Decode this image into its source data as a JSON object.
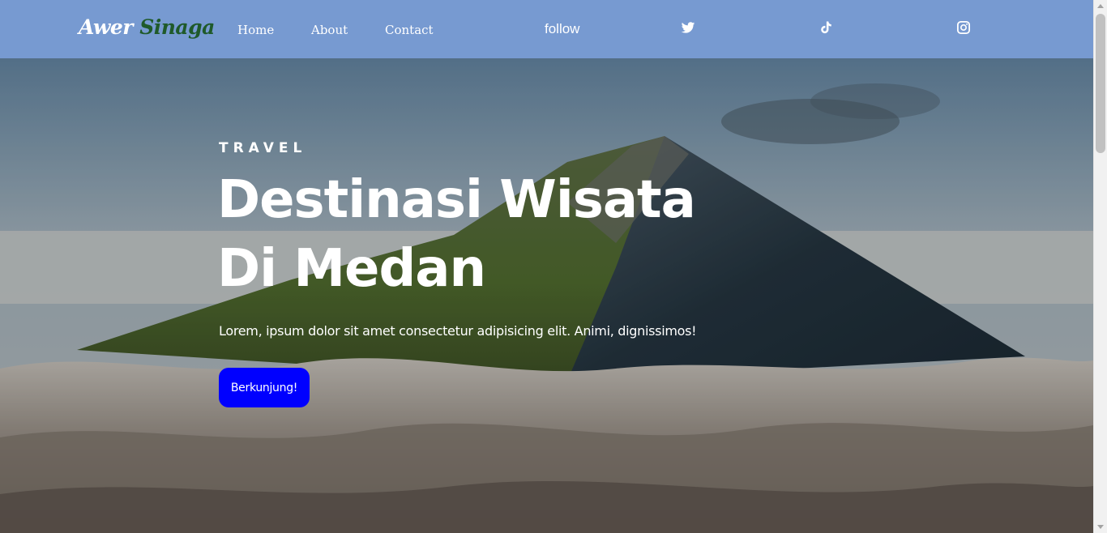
{
  "brand": {
    "first": "Awer",
    "last": "Sinaga"
  },
  "nav": {
    "links": [
      {
        "label": "Home"
      },
      {
        "label": "About"
      },
      {
        "label": "Contact"
      }
    ],
    "follow_label": "follow",
    "social": [
      {
        "icon": "twitter-icon"
      },
      {
        "icon": "tiktok-icon"
      },
      {
        "icon": "instagram-icon"
      }
    ]
  },
  "hero": {
    "kicker": "TRAVEL",
    "headline_line1": "Destinasi Wisata",
    "headline_line2": "Di Medan",
    "subtext": "Lorem, ipsum dolor sit amet consectetur adipisicing elit. Animi, dignissimos!",
    "cta_label": "Berkunjung!",
    "background": "mountain-above-clouds-image"
  },
  "colors": {
    "navbar": "#779ad1",
    "brand_last": "#1f5a2a",
    "cta": "#0000ff",
    "text": "#ffffff"
  }
}
